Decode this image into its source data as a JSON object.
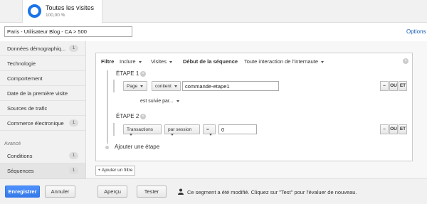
{
  "segment": {
    "title": "Toutes les visites",
    "percent": "100,00 %"
  },
  "segment_name": "Paris - Utilisateur Blog - CA > 500",
  "options_label": "Options",
  "sidebar": {
    "items": [
      {
        "label": "Données démographiq...",
        "count": "1"
      },
      {
        "label": "Technologie",
        "count": ""
      },
      {
        "label": "Comportement",
        "count": ""
      },
      {
        "label": "Date de la première visite",
        "count": ""
      },
      {
        "label": "Sources de trafic",
        "count": ""
      },
      {
        "label": "Commerce électronique",
        "count": "1"
      }
    ],
    "advanced_header": "Avancé",
    "advanced_items": [
      {
        "label": "Conditions",
        "count": "1"
      },
      {
        "label": "Séquences",
        "count": "1"
      }
    ]
  },
  "filter": {
    "label": "Filtre",
    "include": "Inclure",
    "scope": "Visites",
    "sequence_start_label": "Début de la séquence",
    "sequence_start_value": "Toute interaction de l'internaute"
  },
  "steps": [
    {
      "title": "ÉTAPE 1",
      "dimension": "Page",
      "operator": "contient",
      "value": "commande-etape1"
    },
    {
      "title": "ÉTAPE 2",
      "dimension": "Transactions",
      "scope": "par session",
      "operator": "=",
      "value": "0"
    }
  ],
  "followed_by": "est suivie par...",
  "add_step": "Ajouter une étape",
  "row_buttons": {
    "minus": "–",
    "or": "OU",
    "and": "ET"
  },
  "add_filter": "+ Ajouter un filtre",
  "footer": {
    "save": "Enregistrer",
    "cancel": "Annuler",
    "preview": "Aperçu",
    "test": "Tester",
    "message": "Ce segment a été modifié. Cliquez sur \"Test\" pour l'évaluer de nouveau."
  },
  "colors": {
    "primary": "#4d90fe",
    "ring": "#1a73e8",
    "link": "#1a5eb6"
  }
}
